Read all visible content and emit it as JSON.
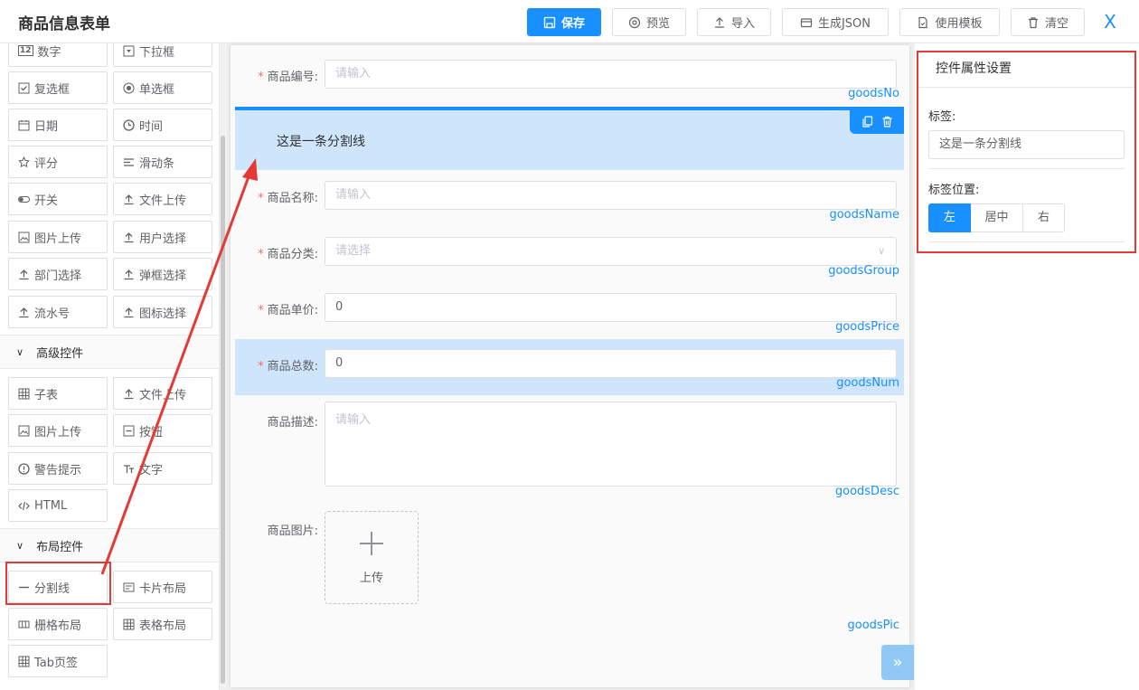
{
  "header": {
    "title": "商品信息表单",
    "buttons": {
      "save": "保存",
      "preview": "预览",
      "import": "导入",
      "json": "生成JSON",
      "template": "使用模板",
      "clear": "清空"
    },
    "close": "X"
  },
  "palette": {
    "basic_items": [
      "数字",
      "下拉框",
      "复选框",
      "单选框",
      "日期",
      "时间",
      "评分",
      "滑动条",
      "开关",
      "文件上传",
      "图片上传",
      "用户选择",
      "部门选择",
      "弹框选择",
      "流水号",
      "图标选择"
    ],
    "advanced_title": "高级控件",
    "advanced_items": [
      "子表",
      "文件上传",
      "图片上传",
      "按钮",
      "警告提示",
      "文字",
      "HTML"
    ],
    "layout_title": "布局控件",
    "layout_items": [
      "分割线",
      "卡片布局",
      "栅格布局",
      "表格布局",
      "Tab页签"
    ]
  },
  "form": {
    "goods_no": {
      "label": "商品编号",
      "placeholder": "请输入",
      "model": "goodsNo"
    },
    "divider": {
      "text": "这是一条分割线"
    },
    "goods_name": {
      "label": "商品名称",
      "placeholder": "请输入",
      "model": "goodsName"
    },
    "goods_group": {
      "label": "商品分类",
      "placeholder": "请选择",
      "model": "goodsGroup"
    },
    "goods_price": {
      "label": "商品单价",
      "value": "0",
      "model": "goodsPrice"
    },
    "goods_num": {
      "label": "商品总数",
      "value": "0",
      "model": "goodsNum"
    },
    "goods_desc": {
      "label": "商品描述",
      "placeholder": "请输入",
      "model": "goodsDesc"
    },
    "goods_pic": {
      "label": "商品图片",
      "upload_text": "上传",
      "model": "goodsPic"
    }
  },
  "props": {
    "title": "控件属性设置",
    "label_title": "标签",
    "label_value": "这是一条分割线",
    "position_title": "标签位置",
    "positions": [
      "左",
      "居中",
      "右"
    ],
    "selected_position": "左"
  },
  "colors": {
    "accent": "#1890ff",
    "highlight": "#cfe5fb",
    "annotation": "#e53935",
    "required": "#f56c6c"
  }
}
